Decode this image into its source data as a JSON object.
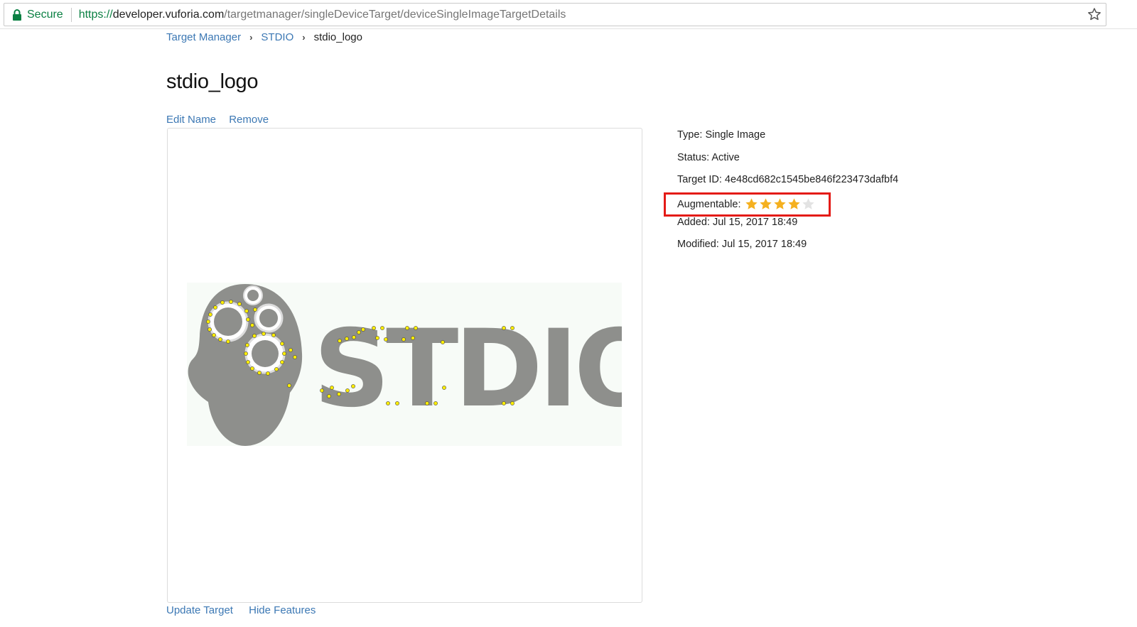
{
  "browser": {
    "secure_label": "Secure",
    "url_https": "https://",
    "url_host": "developer.vuforia.com",
    "url_path": "/targetmanager/singleDeviceTarget/deviceSingleImageTargetDetails",
    "lock_icon": "lock-icon",
    "bookmark_icon": "star-outline-icon",
    "secure_color": "#0b8043"
  },
  "breadcrumb": {
    "items": [
      "Target Manager",
      "STDIO"
    ],
    "current": "stdio_logo",
    "separator": "›"
  },
  "page": {
    "title": "stdio_logo",
    "edit_name": "Edit Name",
    "remove": "Remove",
    "update_target": "Update Target",
    "hide_features": "Hide Features"
  },
  "target_image": {
    "logo_text": "STDIO"
  },
  "details": {
    "type": "Type: Single Image",
    "status": "Status: Active",
    "target_id": "Target ID: 4e48cd682c1545be846f223473dafbf4",
    "augmentable_label": "Augmentable:",
    "augmentable_rating": 4,
    "augmentable_max": 5,
    "added": "Added: Jul 15, 2017 18:49",
    "modified": "Modified: Jul 15, 2017 18:49"
  },
  "colors": {
    "link": "#3c78b4",
    "star_filled": "#f5b01f",
    "star_empty": "#e3e3e3",
    "highlight_border": "#e41b17",
    "logo_gray": "#8e8f8c",
    "feature_yellow": "#ffee00"
  }
}
